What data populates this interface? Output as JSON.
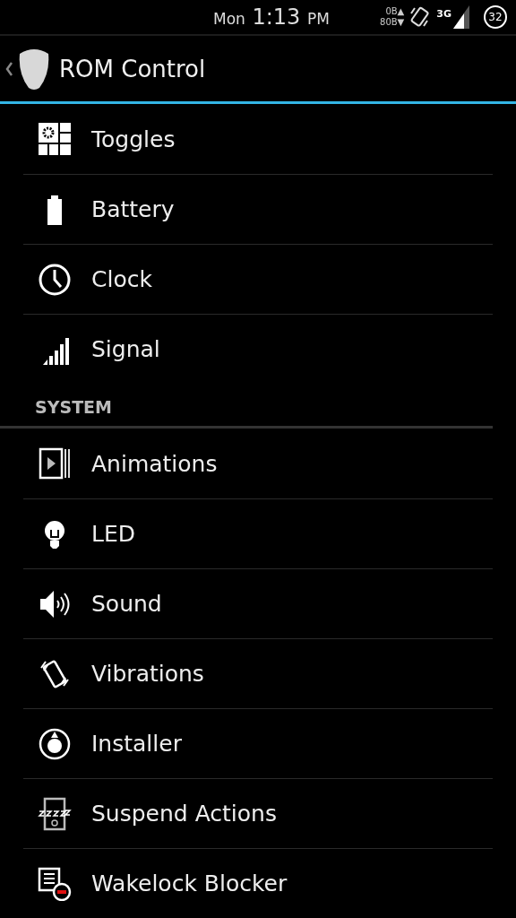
{
  "status_bar": {
    "day": "Mon",
    "time": "1:13",
    "meridiem": "PM",
    "upload": "0B▲",
    "download": "80B▼",
    "network": "3G",
    "battery": "32"
  },
  "action_bar": {
    "title": "ROM Control"
  },
  "sections": [
    {
      "items": [
        {
          "label": "Toggles",
          "kind": "toggles"
        },
        {
          "label": "Battery",
          "kind": "battery"
        },
        {
          "label": "Clock",
          "kind": "clock"
        },
        {
          "label": "Signal",
          "kind": "signal"
        }
      ]
    },
    {
      "header": "SYSTEM",
      "items": [
        {
          "label": "Animations",
          "kind": "animations"
        },
        {
          "label": "LED",
          "kind": "led"
        },
        {
          "label": "Sound",
          "kind": "sound"
        },
        {
          "label": "Vibrations",
          "kind": "vibrations"
        },
        {
          "label": "Installer",
          "kind": "installer"
        },
        {
          "label": "Suspend Actions",
          "kind": "suspend"
        },
        {
          "label": "Wakelock Blocker",
          "kind": "wakelock"
        }
      ]
    }
  ]
}
